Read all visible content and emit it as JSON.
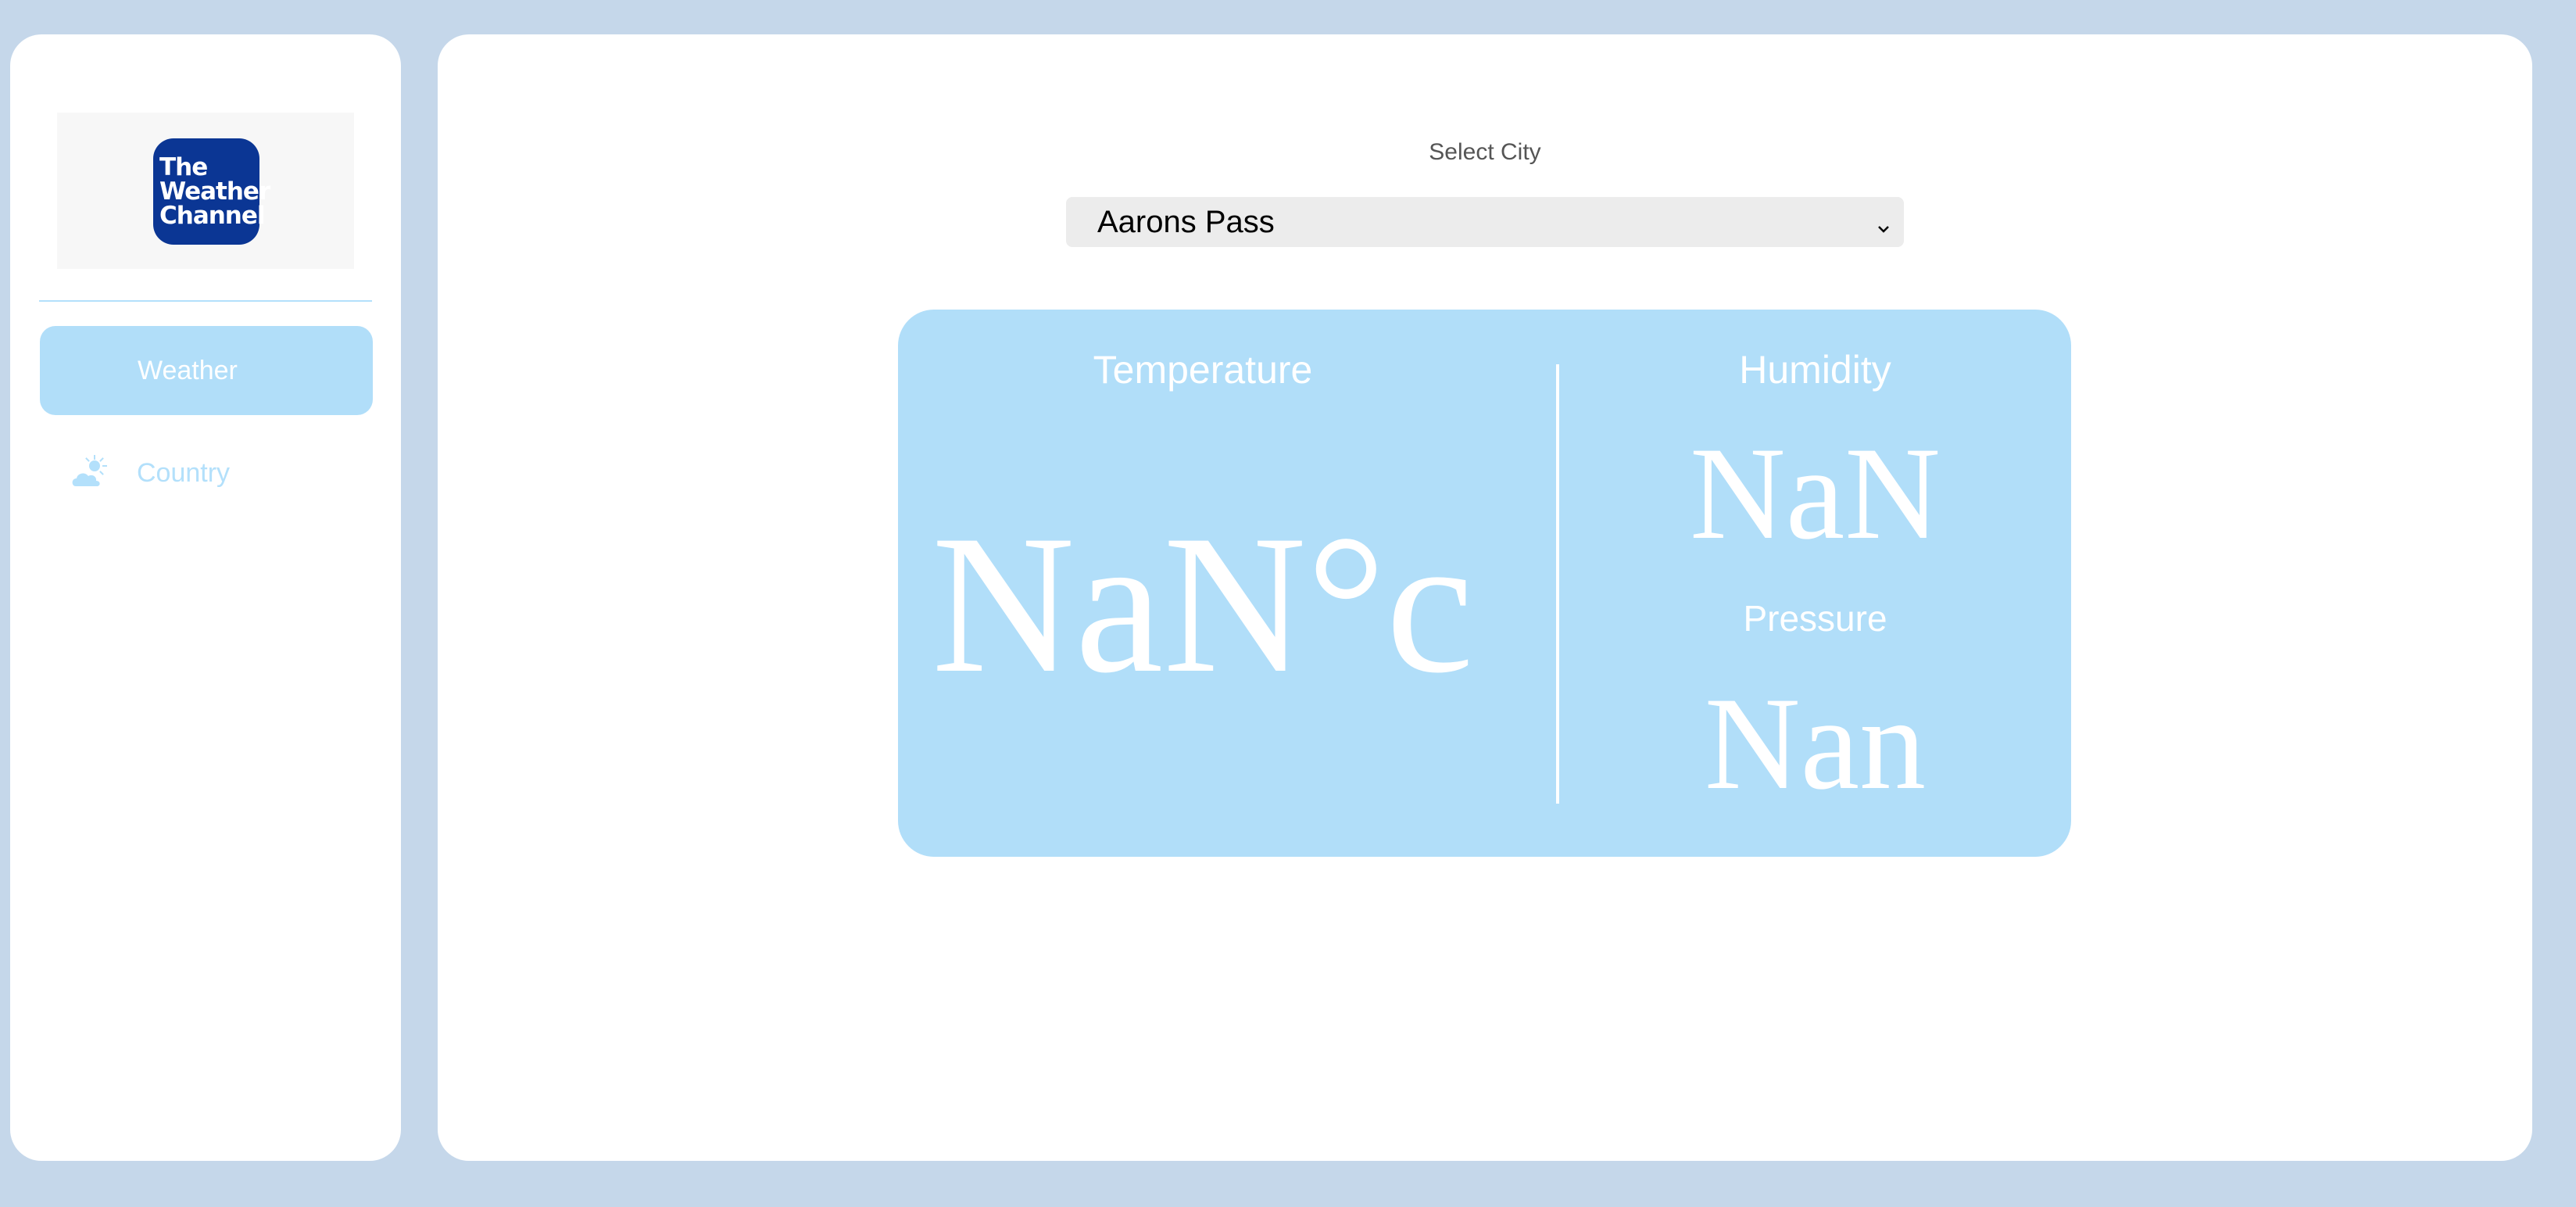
{
  "sidebar": {
    "logo": {
      "line1": "The",
      "line2": "Weather",
      "line3": "Channel",
      "color": "#0b3694"
    },
    "items": [
      {
        "label": "Weather",
        "active": true
      },
      {
        "label": "Country",
        "icon": "partly-cloudy-icon",
        "active": false
      }
    ]
  },
  "main": {
    "select_label": "Select City",
    "city_select": {
      "value": "Aarons Pass"
    },
    "card": {
      "temperature_label": "Temperature",
      "temperature_value": "NaN°c",
      "humidity_label": "Humidity",
      "humidity_value": "NaN",
      "pressure_label": "Pressure",
      "pressure_value": "Nan"
    }
  },
  "colors": {
    "background": "#c5d7ea",
    "accent": "#b1def9",
    "panel": "#ffffff"
  }
}
